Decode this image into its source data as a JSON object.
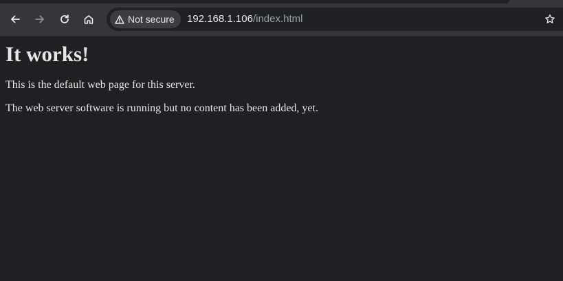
{
  "browser": {
    "security_label": "Not secure",
    "url_host": "192.168.1.106",
    "url_path": "/index.html",
    "icons": [
      "back-arrow-icon",
      "forward-arrow-icon",
      "reload-icon",
      "home-icon",
      "warning-icon",
      "bookmark-star-icon"
    ]
  },
  "page": {
    "heading": "It works!",
    "paragraphs": [
      "This is the default web page for this server.",
      "The web server software is running but no content has been added, yet."
    ]
  },
  "colors": {
    "page_background": "#1f2023",
    "toolbar_background": "#35363a",
    "omnibox_background": "#202124",
    "text": "#e8e6e3"
  }
}
